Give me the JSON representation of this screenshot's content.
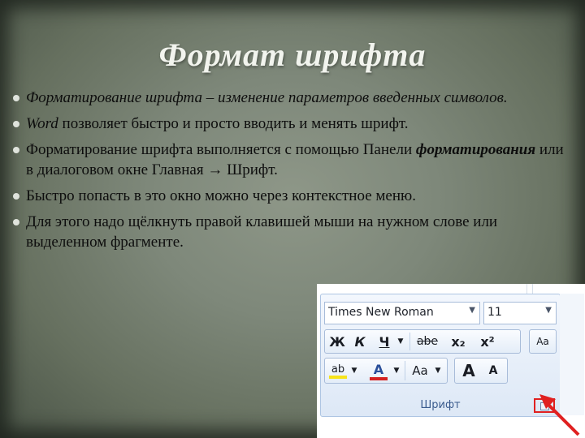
{
  "slide": {
    "title": "Формат шрифта",
    "bullets": [
      {
        "parts": [
          "Форматирование шрифта – изменение параметров введенных символов."
        ]
      },
      {
        "italic": "Word",
        "rest": " позволяет быстро и просто вводить и менять шрифт."
      },
      {
        "before": "Форматирование шрифта выполняется с помощью Панели ",
        "bold_italic": "форматирования",
        "after": " или в диалоговом окне Главная → Шрифт."
      },
      {
        "text": "Быстро попасть в это окно можно через контекстное меню."
      },
      {
        "text": "Для этого надо щёлкнуть правой клавишей мыши на нужном слове или выделенном фрагменте."
      }
    ]
  },
  "ribbon": {
    "font_name": "Times New Roman",
    "font_size": "11",
    "dropdown_arrow": "▼",
    "bold": "Ж",
    "italic": "К",
    "underline": "Ч",
    "strikethrough": "abe",
    "subscript": "x₂",
    "superscript": "x²",
    "clear_format": "Aa",
    "highlight": "ab",
    "font_color": "A",
    "change_case": "Aa",
    "grow": "A",
    "shrink": "A",
    "group_label": "Шрифт",
    "colors": {
      "highlight": "#f7e31a",
      "font_color": "#d42020",
      "launcher_frame": "#e02020"
    }
  }
}
